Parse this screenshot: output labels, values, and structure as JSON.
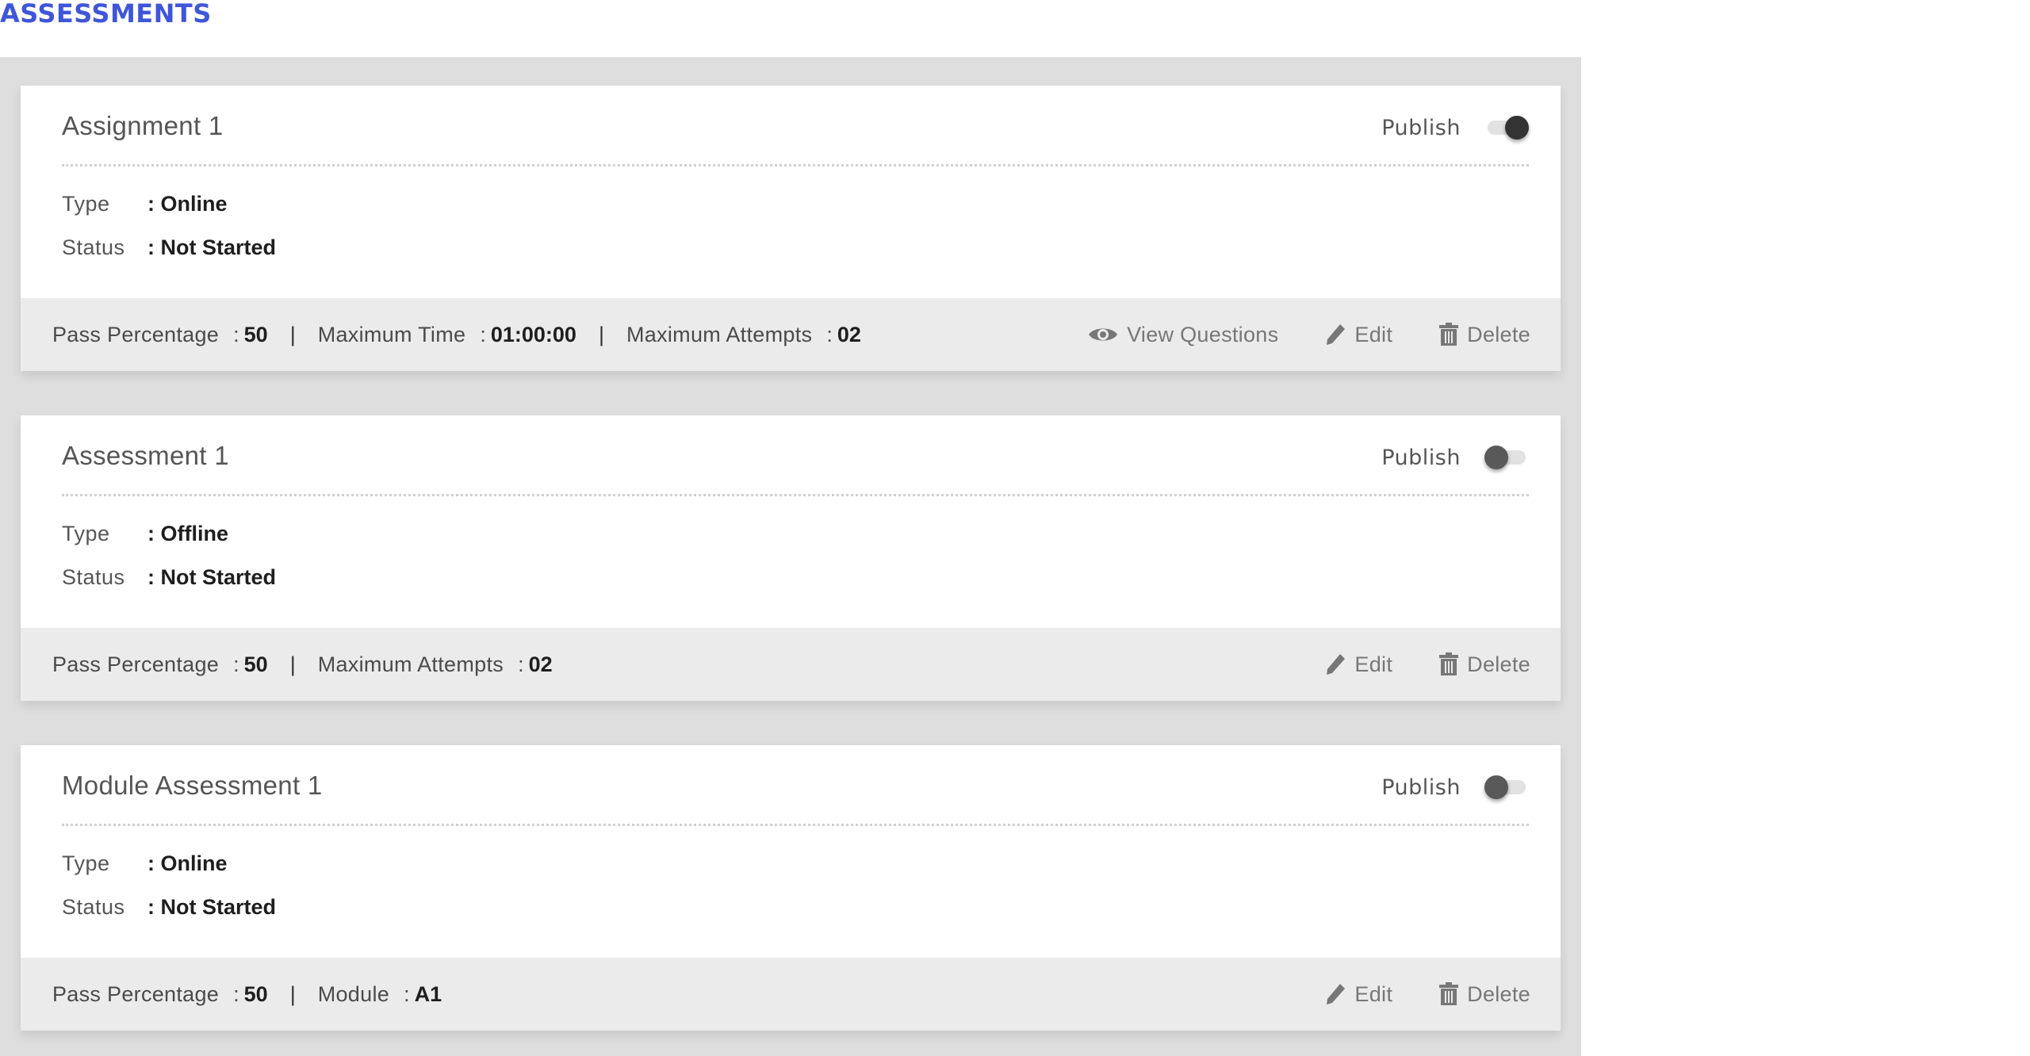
{
  "page": {
    "title": "ASSESSMENTS"
  },
  "cards": [
    {
      "title": "Assignment 1",
      "publish_label": "Publish",
      "published": true,
      "type_label": "Type",
      "type_value": ": Online",
      "status_label": "Status",
      "status_value": ": Not Started",
      "meta": [
        {
          "label": "Pass Percentage",
          "value": "50"
        },
        {
          "label": "Maximum Time",
          "value": "01:00:00"
        },
        {
          "label": "Maximum Attempts",
          "value": "02"
        }
      ],
      "actions": {
        "view": "View Questions",
        "edit": "Edit",
        "delete": "Delete"
      }
    },
    {
      "title": "Assessment 1",
      "publish_label": "Publish",
      "published": false,
      "type_label": "Type",
      "type_value": ": Offline",
      "status_label": "Status",
      "status_value": ": Not Started",
      "meta": [
        {
          "label": "Pass Percentage",
          "value": "50"
        },
        {
          "label": "Maximum Attempts",
          "value": "02"
        }
      ],
      "actions": {
        "edit": "Edit",
        "delete": "Delete"
      }
    },
    {
      "title": "Module Assessment 1",
      "publish_label": "Publish",
      "published": false,
      "type_label": "Type",
      "type_value": ": Online",
      "status_label": "Status",
      "status_value": ": Not Started",
      "meta": [
        {
          "label": "Pass Percentage",
          "value": "50"
        },
        {
          "label": "Module",
          "value": "A1"
        }
      ],
      "actions": {
        "edit": "Edit",
        "delete": "Delete"
      }
    }
  ],
  "colors": {
    "title": "#3f56d8",
    "container": "#dedede",
    "footer": "#ebebeb",
    "toggle_knob": "#3c3c3c"
  }
}
